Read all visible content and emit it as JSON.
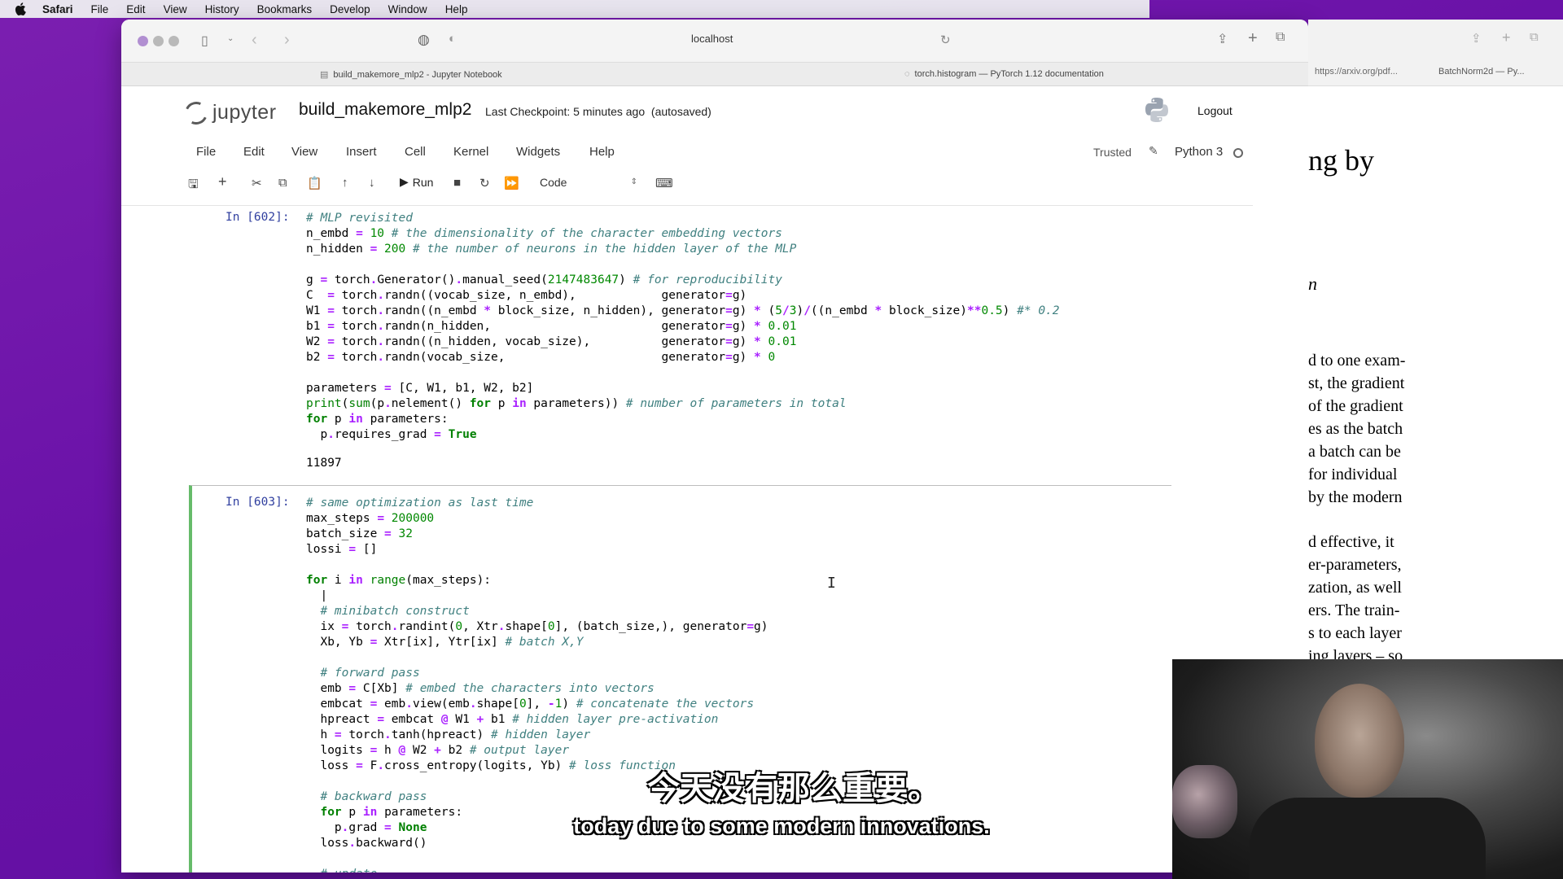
{
  "menubar": {
    "items": [
      "Safari",
      "File",
      "Edit",
      "View",
      "History",
      "Bookmarks",
      "Develop",
      "Window",
      "Help"
    ]
  },
  "browser": {
    "address": "localhost",
    "tabs": [
      {
        "title": "build_makemore_mlp2 - Jupyter Notebook",
        "icon": "document-icon"
      },
      {
        "title": "torch.histogram — PyTorch 1.12 documentation",
        "icon": "loading-icon"
      }
    ]
  },
  "jupyter": {
    "logo_text": "jupyter",
    "notebook_title": "build_makemore_mlp2",
    "checkpoint": "Last Checkpoint: 5 minutes ago",
    "autosave": "(autosaved)",
    "logout": "Logout",
    "menu": [
      "File",
      "Edit",
      "View",
      "Insert",
      "Cell",
      "Kernel",
      "Widgets",
      "Help"
    ],
    "trusted": "Trusted",
    "kernel": "Python 3",
    "run_label": "Run",
    "cell_type": "Code"
  },
  "cells": [
    {
      "prompt": "In [602]:",
      "output": "11897"
    },
    {
      "prompt": "In [603]:"
    }
  ],
  "pdf": {
    "tab1": "https://arxiv.org/pdf...",
    "tab2": "BatchNorm2d — Py...",
    "title": "ng by",
    "italic": "n",
    "lines": [
      "d to one exam-",
      "st, the gradient",
      "of the gradient",
      "es as the batch",
      "a batch can be",
      " for individual",
      "by the modern",
      "d effective, it",
      "er-parameters,",
      "zation, as well",
      "ers.  The train-",
      "s to each layer",
      "ing layers – so"
    ]
  },
  "subtitles": {
    "chinese": "今天没有那么重要。",
    "english": "today due to some modern innovations."
  }
}
